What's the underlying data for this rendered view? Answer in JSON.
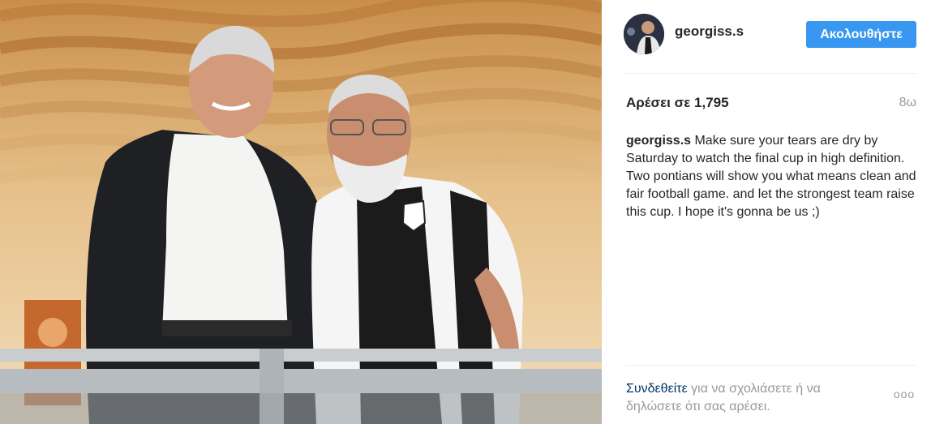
{
  "post": {
    "photo_icon": "stadium-photo"
  },
  "header": {
    "avatar_icon": "user-avatar",
    "username": "georgiss.s",
    "follow_label": "Ακολουθήστε",
    "follow_color": "#3897f0"
  },
  "stats": {
    "likes": "Αρέσει σε 1,795",
    "age": "8ω"
  },
  "caption": {
    "username": "georgiss.s",
    "text": " Make sure your tears are dry by Saturday to watch the final cup in high definition. Two pontians will show you what means clean and fair football game. and let the strongest team raise this cup. I hope it's gonna be us ;)"
  },
  "footer": {
    "login_link": "Συνδεθείτε",
    "login_rest": " για να σχολιάσετε ή να δηλώσετε ότι σας αρέσει.",
    "more_label": "ooo",
    "link_color": "#003569"
  }
}
